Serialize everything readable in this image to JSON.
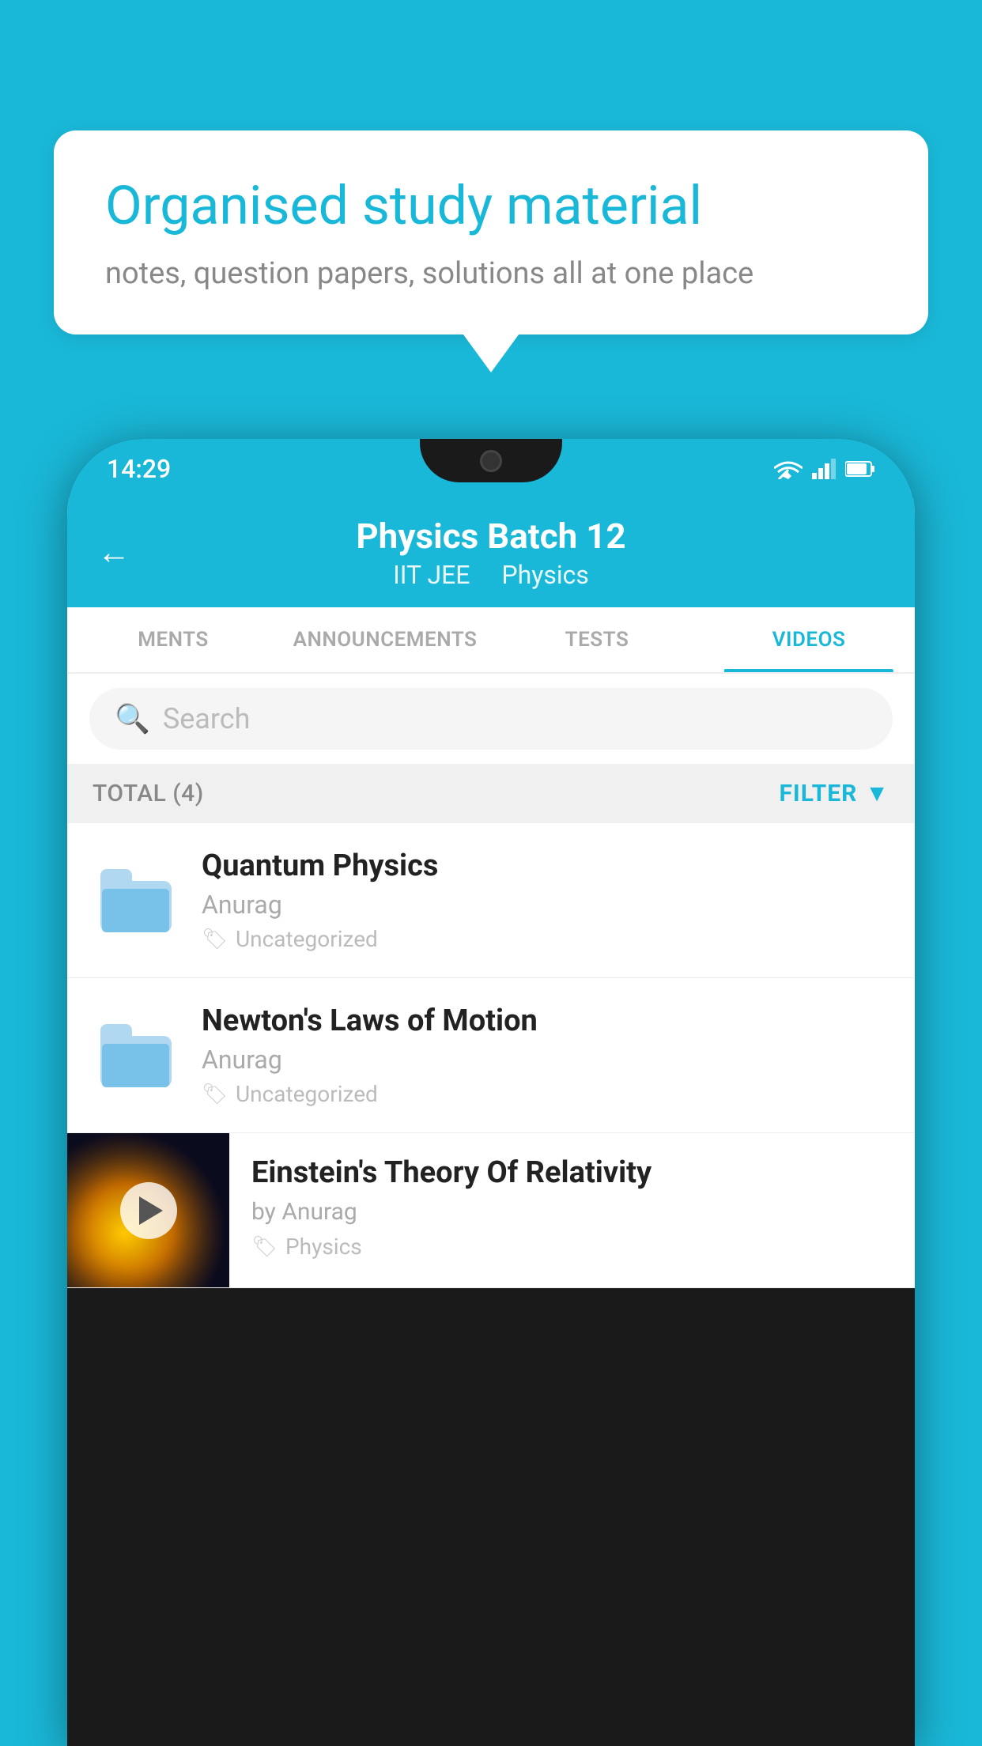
{
  "background_color": "#1ab8d8",
  "speech_bubble": {
    "title": "Organised study material",
    "subtitle": "notes, question papers, solutions all at one place"
  },
  "phone": {
    "status_bar": {
      "time": "14:29",
      "wifi": true,
      "signal": true,
      "battery": true
    },
    "header": {
      "back_label": "←",
      "title": "Physics Batch 12",
      "subtitle_part1": "IIT JEE",
      "subtitle_part2": "Physics"
    },
    "tabs": [
      {
        "label": "MENTS",
        "active": false
      },
      {
        "label": "ANNOUNCEMENTS",
        "active": false
      },
      {
        "label": "TESTS",
        "active": false
      },
      {
        "label": "VIDEOS",
        "active": true
      }
    ],
    "search": {
      "placeholder": "Search"
    },
    "filter_bar": {
      "total_label": "TOTAL (4)",
      "filter_label": "FILTER"
    },
    "videos": [
      {
        "title": "Quantum Physics",
        "author": "Anurag",
        "tag": "Uncategorized",
        "type": "folder"
      },
      {
        "title": "Newton's Laws of Motion",
        "author": "Anurag",
        "tag": "Uncategorized",
        "type": "folder"
      },
      {
        "title": "Einstein's Theory Of Relativity",
        "author": "by Anurag",
        "tag": "Physics",
        "type": "video"
      }
    ]
  }
}
